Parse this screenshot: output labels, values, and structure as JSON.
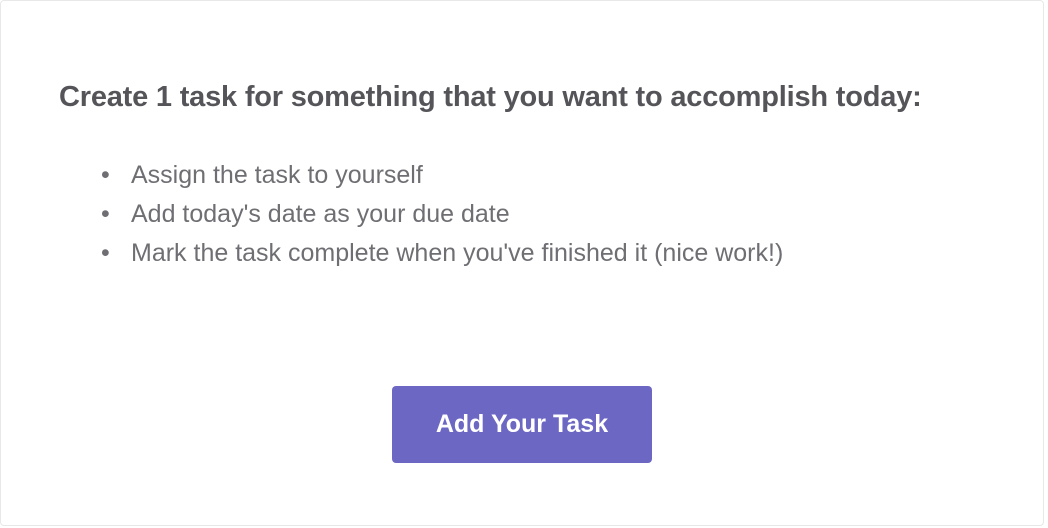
{
  "card": {
    "heading": "Create 1 task for something that you want to accomplish today:",
    "bullets": [
      "Assign the task to yourself",
      "Add today's date as your due date",
      "Mark the task complete when you've finished it (nice work!)"
    ],
    "cta_label": "Add Your Task"
  },
  "colors": {
    "accent": "#6d67c4",
    "heading_text": "#555459",
    "body_text": "#6f6e73"
  }
}
